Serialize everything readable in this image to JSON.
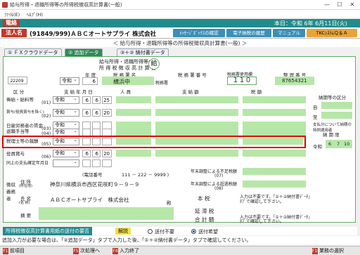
{
  "window": {
    "title": "給与所得・退職所得等の所得税徴収高計算書(一般)",
    "minimize": "—",
    "maximize": "☐",
    "close": "✕"
  },
  "menu": {
    "file": "ﾌｧｲﾙ(E)",
    "help": "ﾍﾙﾌﾟ(H)"
  },
  "band": {
    "left_label": "電絡",
    "date": "本日：令和 6年 6月11日(火)"
  },
  "corp": {
    "label": "法人名",
    "name": "(91849/999)ＡＢＣオートサプライ 株式会社"
  },
  "top_buttons": [
    "ﾒｯｾｰｼﾞﾎﾞｯｸｽの確認",
    "電子納税の履歴",
    "マニュアル",
    "TKCｼｽﾃﾑＱ＆Ａ"
  ],
  "subtitle": "＜ 給与所得・退職所得等の所得税徴収高計算書(一般) ＞",
  "tabs": [
    "① ＦＸクラウドデータ",
    "② 追加データ",
    "③＋② 納付書データ"
  ],
  "form": {
    "header_title_1": "給与所得・退職所得等の",
    "header_title_2": "所 得 税 徴 収 高 計 算 書",
    "kyu_char": "給",
    "code": "22209",
    "year_label": "年 度",
    "era": "令和",
    "year": "6",
    "zeimusho_label": "税 務 署 名",
    "zeimusho": "横浜中",
    "zeimusho_suffix": "税務署",
    "zeimusho_no_label": "税 務 署 番 号",
    "zeimusho_no_hint": "税務署使用欄",
    "zeimusho_no": "１１０",
    "seiri_label": "整 理 番 号",
    "seiri": "87654321",
    "col_kubun": "区 分",
    "col_shikyu": "支 給 年 月 日",
    "col_jinin": "人 員",
    "col_shikyugaku": "支 給 額",
    "col_zeigaku": "税 額",
    "rows": [
      {
        "label": "俸給・給料等",
        "code": "(01)",
        "era": "令和",
        "y": "6",
        "m": "6",
        "d": "25"
      },
      {
        "label": "賞与(役員賞与を除く)",
        "code": "(02)",
        "era": "令和",
        "y": "6",
        "m": "6",
        "d": "20"
      },
      {
        "label": "日雇労務者の賃金",
        "code": "(03)",
        "era": "令和",
        "y": "",
        "m": "",
        "d": ""
      },
      {
        "label": "退職手当等",
        "code": "(04)",
        "era": "令和",
        "y": "",
        "m": "",
        "d": ""
      },
      {
        "label": "税理士等の報酬",
        "code": "(05)",
        "era": "令和",
        "y": "",
        "m": "",
        "d": ""
      },
      {
        "label": "役員賞与",
        "code": "(06)",
        "era": "令和",
        "y": "6",
        "m": "6",
        "d": "20"
      },
      {
        "label": "同上の支払確定年月日",
        "code": "",
        "era": "",
        "y": "",
        "m": "",
        "d": ""
      }
    ],
    "nofu_kubun_label": "納期等の区分",
    "nofu_kubun_from": "自",
    "nofu_kubun_to": "至",
    "nofu_note": "支払分について納期の特例適用者",
    "nofu_gen_label": "納 期 限",
    "nofu_gen_era": "令和",
    "nofu_gen_y": "6",
    "nofu_gen_m": "7",
    "nofu_gen_d": "10",
    "chosei_fusoku": "年末調整による不足税額",
    "chosei_fusoku_code": "(07)",
    "chosei_kanpu": "年末調整による超過税額",
    "chosei_kanpu_code": "(08)",
    "honzei": "本 税",
    "entai": "延 滞 税",
    "goukei": "合 計 額",
    "hint_text_1": "入力は不要です。「①＋②納付書ﾃﾞｰﾀ」",
    "hint_text_2": "ﾀﾌﾞで確認して下さい。",
    "tel_label": "(電話番号",
    "tel": "111 － 222 － 9999 )",
    "choshu_label": "徴収義務者",
    "jusho_label": "住 所",
    "jusho_sub": "(所在地)",
    "jusho": "神奈川県横浜市西区花咲町９－９－９",
    "shimei_label": "氏 名",
    "shimei_sub": "(名 称)",
    "shimei": "ＡＢＣオートサプライ　株式会社",
    "den": "殿",
    "tekiyo_label": "摘 要"
  },
  "bottom": {
    "label": "所得税徴収高計算書用紙の送付の要否",
    "kaisetsu": "解説",
    "opt1": "送付不要",
    "opt2": "送付希望"
  },
  "notice": "追加入力が必要な場合は、「②追加データ」タブで入力した後、「①＋②納付書データ」タブで確認してください。",
  "fkeys": [
    {
      "key": "F1",
      "label": "前項目"
    },
    {
      "key": "F5",
      "label": "次処理へ"
    },
    {
      "key": "F4",
      "label": "入力終了"
    },
    {
      "key": "F10",
      "label": "業務の選択"
    }
  ]
}
